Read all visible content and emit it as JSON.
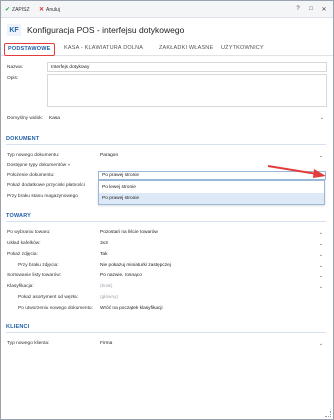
{
  "toolbar": {
    "save_label": "ZAPISZ",
    "cancel_label": "Anuluj",
    "help_glyph": "?",
    "maximize_glyph": "□",
    "close_glyph": "✕"
  },
  "header": {
    "logo_text": "KF",
    "title": "Konfiguracja POS - interfejsu dotykowego"
  },
  "tabs": [
    "PODSTAWOWE",
    "KASA - KLAWIATURA DOLNA",
    "ZAKŁADKI WŁASNE",
    "UŻYTKOWNICY"
  ],
  "general": {
    "name_label": "Nazwa:",
    "name_value": "Interfejs dotykowy",
    "desc_label": "Opis:",
    "desc_value": "",
    "default_view_label": "Domyślny widok:",
    "default_view_value": "Kasa"
  },
  "dokument": {
    "section_title": "DOKUMENT",
    "new_doc_type_label": "Typ nowego dokumentu:",
    "new_doc_type_value": "Paragon",
    "available_types_label": "Dostępne typy dokumentów »",
    "doc_position_label": "Położenie dokumentu:",
    "doc_position_value": "Po prawej stronie",
    "show_payment_buttons_label": "Pokaż dodatkowe przyciski płatności",
    "out_of_stock_label": "Przy braku stanu magazynowego",
    "dropdown_options": [
      "Po lewej stronie",
      "Po prawej stronie"
    ]
  },
  "towary": {
    "section_title": "TOWARY",
    "after_select_label": "Po wybraniu towaru:",
    "after_select_value": "Pozostań na liście towarów",
    "tile_layout_label": "Układ kafelków:",
    "tile_layout_value": "3x3",
    "show_images_label": "Pokaż zdjęcia:",
    "show_images_value": "Tak",
    "no_image_label": "Przy braku zdjęcia:",
    "no_image_value": "Nie pokazuj miniaturki zastępczej",
    "sort_label": "Sortowanie listy towarów:",
    "sort_value": "Po nazwie, rosnąco",
    "classification_label": "Klasyfikacja:",
    "classification_value": "(brak)",
    "assortment_label": "Pokaż asortyment od węzła:",
    "assortment_value": "(główny)",
    "after_new_doc_label": "Po utworzeniu nowego dokumentu:",
    "after_new_doc_value": "Wróć na początek klasyfikacji"
  },
  "klienci": {
    "section_title": "KLIENCI",
    "new_client_type_label": "Typ nowego klienta:",
    "new_client_type_value": "Firma"
  },
  "colors": {
    "accent": "#1f5fa8",
    "highlight": "#e33c3c",
    "save_green": "#27a844"
  }
}
